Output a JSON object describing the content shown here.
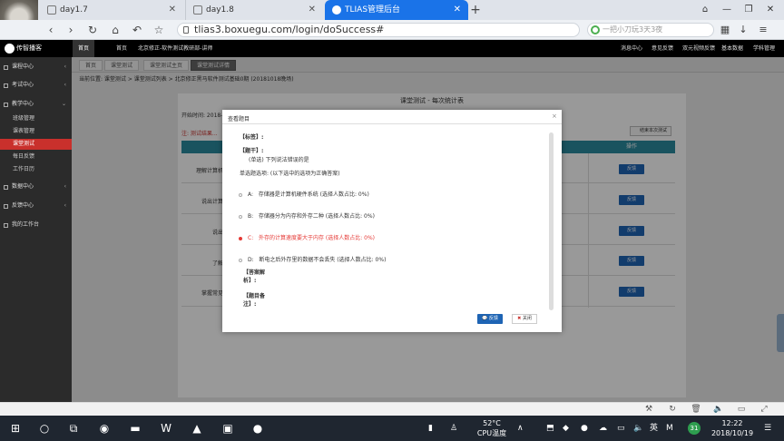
{
  "browser": {
    "tabs": [
      {
        "title": "day1.7"
      },
      {
        "title": "day1.8"
      },
      {
        "title": "TLIAS管理后台"
      }
    ],
    "url": "tlias3.boxuegu.com/login/doSuccess#",
    "search_placeholder": "一把小刀玩3天3夜"
  },
  "app": {
    "logo": "传智播客",
    "nav": {
      "active": "首页",
      "home": "首页",
      "org": "北京修正-软件测试教研部-讲师"
    },
    "nav_right": [
      "消息中心",
      "意见反馈",
      "双元视频反馈",
      "基本数据",
      "学科管理"
    ],
    "sidebar": {
      "groups": [
        "课程中心",
        "考试中心",
        "教学中心",
        "数据中心",
        "反馈中心",
        "我的工作台"
      ],
      "teach_items": [
        "班级管理",
        "课表管理",
        "课堂测试",
        "每日反馈",
        "工作日历"
      ]
    },
    "content_tabs": [
      "首页",
      "课堂测试",
      "课堂测试主页",
      "课堂测试详情"
    ],
    "breadcrumb": "当前位置: 课堂测试 > 课堂测试列表 > 北京修正黑马软件测试基础0期 (20181018晚场)",
    "page_title": "课堂测试 - 每次统计表",
    "start_time": "开始时间: 2018-1",
    "tip": "注: 测试结果...",
    "end_button": "结束本次测试",
    "table_header_op": "操作",
    "rows": [
      {
        "question": "理解计算机",
        "action": "反馈"
      },
      {
        "question": "说出计算",
        "action": "反馈"
      },
      {
        "question": "说出",
        "action": "反馈"
      },
      {
        "question": "了解",
        "action": "反馈"
      },
      {
        "question": "掌握常见",
        "action": "反馈"
      }
    ]
  },
  "modal": {
    "title": "查看题目",
    "tag_label": "【标签】:",
    "stem_label": "【题干】:",
    "stem_text": "(单选) 下列说法错误的是",
    "hint": "单选题选项: (以下选中的选项为正确答案)",
    "options": [
      {
        "key": "A",
        "text": "存储器是计算机硬件系统  (选择人数占比: 0%)",
        "selected": false
      },
      {
        "key": "B",
        "text": "存储器分为内存和外存二种  (选择人数占比: 0%)",
        "selected": false
      },
      {
        "key": "C",
        "text": "外存的计算速度要大于内存  (选择人数占比: 0%)",
        "selected": true
      },
      {
        "key": "D",
        "text": "断电之后外存里的数据不会丢失  (选择人数占比: 0%)",
        "selected": false
      }
    ],
    "analysis_label": "【答案解析】:",
    "remark_label": "【题目备注】:",
    "feedback_button": "反馈",
    "close_button": "关闭"
  },
  "taskbar": {
    "temperature": "52°C",
    "temp_label": "CPU温度",
    "ime": "英",
    "time": "12:22",
    "date": "2018/10/19",
    "badge": "31"
  }
}
